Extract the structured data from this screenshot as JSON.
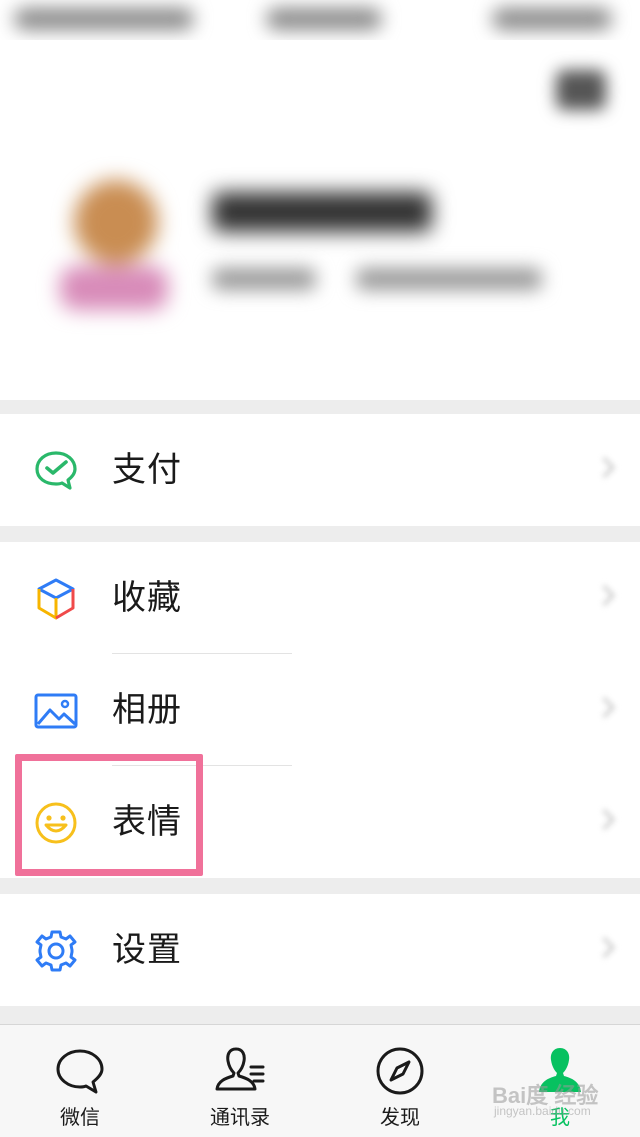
{
  "menu": {
    "pay": {
      "label": "支付",
      "icon": "wechat-pay-icon"
    },
    "favorites": {
      "label": "收藏",
      "icon": "favorites-cube-icon"
    },
    "album": {
      "label": "相册",
      "icon": "photo-album-icon"
    },
    "stickers": {
      "label": "表情",
      "icon": "smiley-icon",
      "highlighted": true
    },
    "settings": {
      "label": "设置",
      "icon": "gear-icon"
    }
  },
  "tabbar": {
    "tabs": [
      {
        "label": "微信",
        "icon": "chat-bubble-icon",
        "active": false
      },
      {
        "label": "通讯录",
        "icon": "contacts-icon",
        "active": false
      },
      {
        "label": "发现",
        "icon": "compass-icon",
        "active": false
      },
      {
        "label": "我",
        "icon": "person-icon",
        "active": true
      }
    ]
  },
  "watermark": {
    "brand": "Bai度 经验",
    "url": "jingyan.baidu.com"
  },
  "colors": {
    "accent": "#07c160",
    "highlight": "#f0719a",
    "background": "#ededed",
    "pay_icon": "#2ab86a",
    "album_icon": "#2f7cf6",
    "sticker_icon": "#f7c01c",
    "settings_icon": "#2f7cf6"
  }
}
